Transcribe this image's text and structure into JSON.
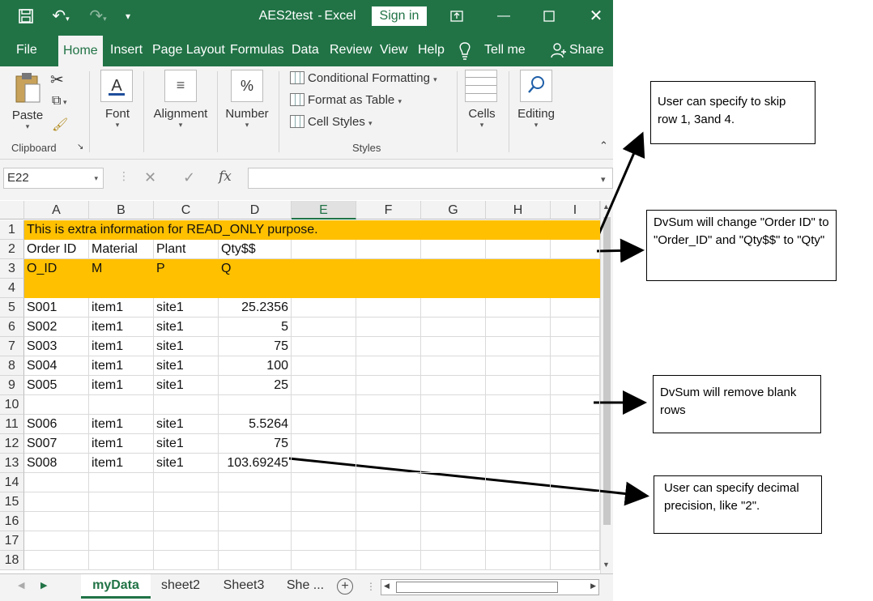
{
  "titlebar": {
    "doc_title": "AES2test",
    "app_name": "Excel",
    "signin_label": "Sign in"
  },
  "tabs": [
    "File",
    "Home",
    "Insert",
    "Page Layout",
    "Formulas",
    "Data",
    "Review",
    "View",
    "Help",
    "Tell me",
    "Share"
  ],
  "ribbon": {
    "paste": "Paste",
    "clipboard": "Clipboard",
    "font": "Font",
    "alignment": "Alignment",
    "number": "Number",
    "conditional_formatting": "Conditional Formatting",
    "format_as_table": "Format as Table",
    "cell_styles": "Cell Styles",
    "styles": "Styles",
    "cells": "Cells",
    "editing": "Editing"
  },
  "formula_bar": {
    "name_box": "E22",
    "fx": "fx"
  },
  "columns": [
    "A",
    "B",
    "C",
    "D",
    "E",
    "F",
    "G",
    "H",
    "I"
  ],
  "rows": [
    {
      "n": "1",
      "a": "This is extra information for READ_ONLY purpose.",
      "b": "",
      "c": "",
      "d": ""
    },
    {
      "n": "2",
      "a": "Order ID",
      "b": "Material",
      "c": "Plant",
      "d": "Qty$$"
    },
    {
      "n": "3",
      "a": "O_ID",
      "b": "M",
      "c": "P",
      "d": "Q"
    },
    {
      "n": "4",
      "a": "",
      "b": "",
      "c": "",
      "d": ""
    },
    {
      "n": "5",
      "a": "S001",
      "b": "item1",
      "c": "site1",
      "d": "25.2356"
    },
    {
      "n": "6",
      "a": "S002",
      "b": "item1",
      "c": "site1",
      "d": "5"
    },
    {
      "n": "7",
      "a": "S003",
      "b": "item1",
      "c": "site1",
      "d": "75"
    },
    {
      "n": "8",
      "a": "S004",
      "b": "item1",
      "c": "site1",
      "d": "100"
    },
    {
      "n": "9",
      "a": "S005",
      "b": "item1",
      "c": "site1",
      "d": "25"
    },
    {
      "n": "10",
      "a": "",
      "b": "",
      "c": "",
      "d": ""
    },
    {
      "n": "11",
      "a": "S006",
      "b": "item1",
      "c": "site1",
      "d": "5.5264"
    },
    {
      "n": "12",
      "a": "S007",
      "b": "item1",
      "c": "site1",
      "d": "75"
    },
    {
      "n": "13",
      "a": "S008",
      "b": "item1",
      "c": "site1",
      "d": "103.69245"
    },
    {
      "n": "14",
      "a": "",
      "b": "",
      "c": "",
      "d": ""
    },
    {
      "n": "15",
      "a": "",
      "b": "",
      "c": "",
      "d": ""
    },
    {
      "n": "16",
      "a": "",
      "b": "",
      "c": "",
      "d": ""
    },
    {
      "n": "17",
      "a": "",
      "b": "",
      "c": "",
      "d": ""
    },
    {
      "n": "18",
      "a": "",
      "b": "",
      "c": "",
      "d": ""
    }
  ],
  "sheets": [
    "myData",
    "sheet2",
    "Sheet3",
    "She ..."
  ],
  "notes": {
    "skip_rows": "User can specify to skip row 1, 3and 4.",
    "rename": "DvSum will change \"Order ID\" to \"Order_ID\" and \"Qty$$\" to \"Qty\"",
    "blank_rows": "DvSum will remove blank rows",
    "precision": "User can specify  decimal precision, like \"2\"."
  },
  "colors": {
    "excel_green": "#217346",
    "highlight": "#ffc000"
  }
}
